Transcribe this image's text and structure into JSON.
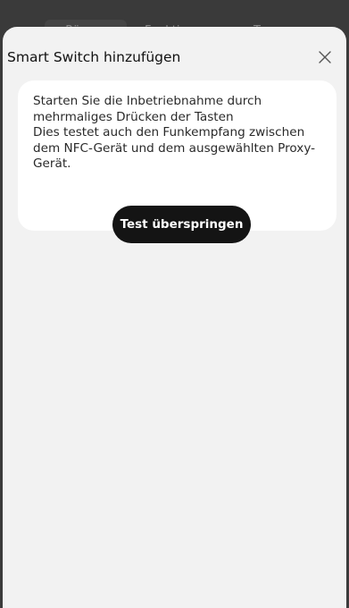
{
  "background": {
    "tabs": [
      "Räume",
      "Funktionen",
      "Typen"
    ]
  },
  "modal": {
    "title": "Smart Switch hinzufügen",
    "close_icon": "close-icon",
    "instructions": [
      "Starten Sie die Inbetriebnahme durch",
      "mehrmaliges Drücken der Tasten",
      "Dies testet auch den Funkempfang zwischen",
      "dem NFC-Gerät und dem ausgewählten Proxy-",
      "Gerät."
    ],
    "skip_button_label": "Test überspringen"
  },
  "colors": {
    "sheet_background": "#f2f2f2",
    "card_background": "#ffffff",
    "button_background": "#141414",
    "button_text": "#ffffff",
    "overlay": "#3b3b3b"
  }
}
